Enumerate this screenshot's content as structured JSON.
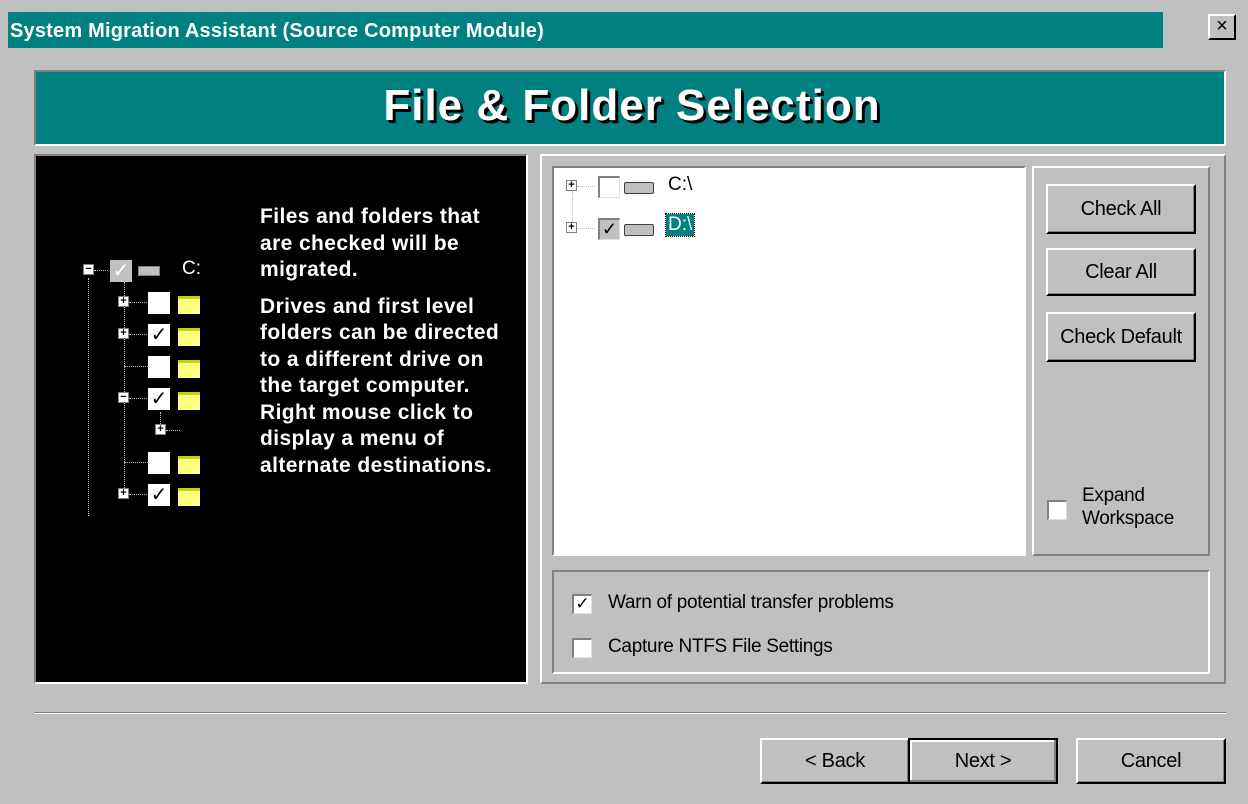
{
  "window": {
    "title": "System Migration Assistant (Source Computer Module)",
    "close_glyph": "×"
  },
  "banner": {
    "title": "File & Folder Selection"
  },
  "info": {
    "paragraph1": "Files and folders that are checked will be migrated.",
    "paragraph2": "Drives and first level folders can be directed to a different drive on the target computer.  Right mouse click to display a menu of alternate destinations."
  },
  "illustration": {
    "root_label": "C:",
    "rows": [
      {
        "expander": "+",
        "checked": false
      },
      {
        "expander": "+",
        "checked": true
      },
      {
        "expander": "",
        "checked": false
      },
      {
        "expander": "-",
        "checked": true
      },
      {
        "expander": "",
        "checked": false
      },
      {
        "expander": "+",
        "checked": true
      }
    ]
  },
  "tree": {
    "items": [
      {
        "label": "C:\\",
        "checked": false,
        "selected": false,
        "expander": "+"
      },
      {
        "label": "D:\\",
        "checked": true,
        "selected": true,
        "expander": "+"
      }
    ]
  },
  "buttons": {
    "check_all": "Check All",
    "clear_all": "Clear All",
    "check_default": "Check Default"
  },
  "expand_workspace": {
    "label_line1": "Expand",
    "label_line2": "Workspace",
    "checked": false
  },
  "options": {
    "warn_label": "Warn of potential transfer problems",
    "warn_checked": true,
    "ntfs_label": "Capture NTFS File Settings",
    "ntfs_checked": false
  },
  "footer": {
    "back": "< Back",
    "next": "Next >",
    "cancel": "Cancel"
  },
  "colors": {
    "teal": "#008080",
    "face": "#c0c0c0"
  }
}
